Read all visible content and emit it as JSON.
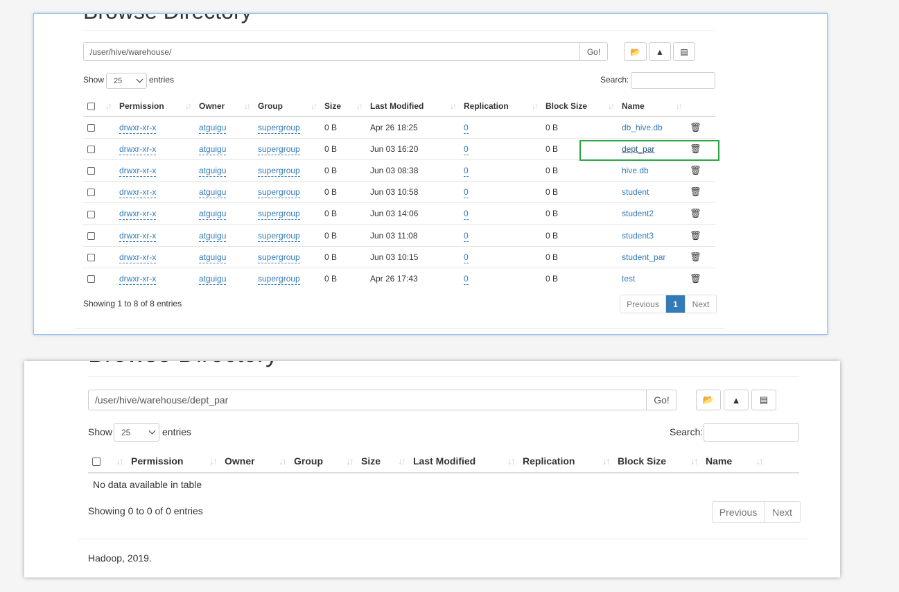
{
  "top": {
    "heading": "Browse Directory",
    "path": "/user/hive/warehouse/",
    "go": "Go!",
    "show_label": "Show",
    "page_size": "25",
    "entries_label": "entries",
    "search_label": "Search:",
    "search_value": "",
    "columns": [
      "Permission",
      "Owner",
      "Group",
      "Size",
      "Last Modified",
      "Replication",
      "Block Size",
      "Name"
    ],
    "rows": [
      {
        "perm": "drwxr-xr-x",
        "owner": "atguigu",
        "group": "supergroup",
        "size": "0 B",
        "mod": "Apr 26 18:25",
        "repl": "0",
        "block": "0 B",
        "name": "db_hive.db"
      },
      {
        "perm": "drwxr-xr-x",
        "owner": "atguigu",
        "group": "supergroup",
        "size": "0 B",
        "mod": "Jun 03 16:20",
        "repl": "0",
        "block": "0 B",
        "name": "dept_par"
      },
      {
        "perm": "drwxr-xr-x",
        "owner": "atguigu",
        "group": "supergroup",
        "size": "0 B",
        "mod": "Jun 03 08:38",
        "repl": "0",
        "block": "0 B",
        "name": "hive.db"
      },
      {
        "perm": "drwxr-xr-x",
        "owner": "atguigu",
        "group": "supergroup",
        "size": "0 B",
        "mod": "Jun 03 10:58",
        "repl": "0",
        "block": "0 B",
        "name": "student"
      },
      {
        "perm": "drwxr-xr-x",
        "owner": "atguigu",
        "group": "supergroup",
        "size": "0 B",
        "mod": "Jun 03 14:06",
        "repl": "0",
        "block": "0 B",
        "name": "student2"
      },
      {
        "perm": "drwxr-xr-x",
        "owner": "atguigu",
        "group": "supergroup",
        "size": "0 B",
        "mod": "Jun 03 11:08",
        "repl": "0",
        "block": "0 B",
        "name": "student3"
      },
      {
        "perm": "drwxr-xr-x",
        "owner": "atguigu",
        "group": "supergroup",
        "size": "0 B",
        "mod": "Jun 03 10:15",
        "repl": "0",
        "block": "0 B",
        "name": "student_par"
      },
      {
        "perm": "drwxr-xr-x",
        "owner": "atguigu",
        "group": "supergroup",
        "size": "0 B",
        "mod": "Apr 26 17:43",
        "repl": "0",
        "block": "0 B",
        "name": "test"
      }
    ],
    "info": "Showing 1 to 8 of 8 entries",
    "prev": "Previous",
    "page": "1",
    "next": "Next",
    "highlight_color": "#28a745"
  },
  "bottom": {
    "heading": "Browse Directory",
    "path": "/user/hive/warehouse/dept_par",
    "go": "Go!",
    "show_label": "Show",
    "page_size": "25",
    "entries_label": "entries",
    "search_label": "Search:",
    "search_value": "",
    "columns": [
      "Permission",
      "Owner",
      "Group",
      "Size",
      "Last Modified",
      "Replication",
      "Block Size",
      "Name"
    ],
    "empty": "No data available in table",
    "info": "Showing 0 to 0 of 0 entries",
    "prev": "Previous",
    "next": "Next",
    "footer": "Hadoop, 2019."
  },
  "icons": {
    "folder": "folder-open-icon",
    "upload": "cloud-upload-icon",
    "list": "list-alt-icon",
    "trash": "trash-icon",
    "sort": "sort-icon"
  },
  "colors": {
    "link": "#337ab7",
    "active_page": "#337ab7"
  }
}
